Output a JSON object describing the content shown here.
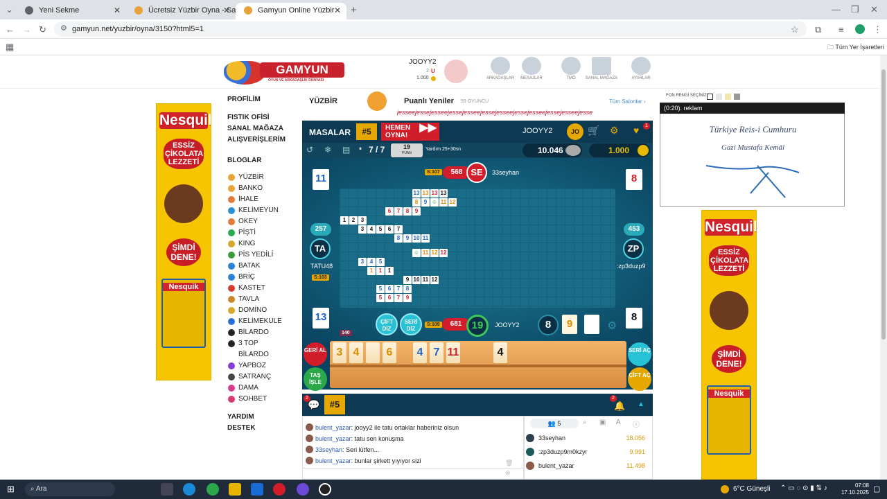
{
  "browser": {
    "tabs": [
      {
        "label": "Yeni Sekme"
      },
      {
        "label": "Ücretsiz Yüzbir Oyna - Salon Lis"
      },
      {
        "label": "Gamyun Online Yüzbir"
      }
    ],
    "url": "gamyun.net/yuzbir/oyna/3150?html5=1",
    "bookmarks_label": "Tüm Yer İşaretleri"
  },
  "header": {
    "logo_text": "GAMYUN",
    "logo_sub": "OYUN VE ARKADAŞLIK DÜNYASI",
    "username": "JOOYY2",
    "level": "2",
    "coins": "1.000",
    "nav": [
      {
        "label": "ARKADAŞLAR"
      },
      {
        "label": "MESAJLAR"
      },
      {
        "label": "TMÖ"
      },
      {
        "label": "SANAL MAĞAZA"
      },
      {
        "label": "AYARLAR"
      }
    ]
  },
  "leftmenu": {
    "top_links": [
      "PROFİLİM",
      "FISTIK OFİSİ",
      "SANAL MAĞAZA",
      "ALIŞVERİŞLERİM",
      "BLOGLAR"
    ],
    "games": [
      {
        "label": "YÜZBİR",
        "color": "#e8a23a"
      },
      {
        "label": "BANKO",
        "color": "#e8a23a"
      },
      {
        "label": "İHALE",
        "color": "#e07b39"
      },
      {
        "label": "KELİMEYUN",
        "color": "#2a8fd6"
      },
      {
        "label": "OKEY",
        "color": "#e07b39"
      },
      {
        "label": "PİŞTİ",
        "color": "#2aa84a"
      },
      {
        "label": "KING",
        "color": "#d6a52a"
      },
      {
        "label": "PİS YEDİLİ",
        "color": "#3a9a3a"
      },
      {
        "label": "BATAK",
        "color": "#2a7fd6"
      },
      {
        "label": "BRİÇ",
        "color": "#2a7fd6"
      },
      {
        "label": "KASTET",
        "color": "#d63a2a"
      },
      {
        "label": "TAVLA",
        "color": "#c9882a"
      },
      {
        "label": "DOMİNO",
        "color": "#d6a52a"
      },
      {
        "label": "KELİMEKULE",
        "color": "#2a6fd6"
      },
      {
        "label": "BİLARDO",
        "color": "#222222"
      },
      {
        "label": "3 TOP BİLARDO",
        "color": "#222222"
      },
      {
        "label": "YAPBOZ",
        "color": "#8a3ad6"
      },
      {
        "label": "SATRANÇ",
        "color": "#444444"
      },
      {
        "label": "DAMA",
        "color": "#d63a8a"
      },
      {
        "label": "SOHBET",
        "color": "#d63a6a"
      }
    ],
    "bottom_links": [
      "YARDIM",
      "DESTEK"
    ]
  },
  "ads": {
    "brand": "Nesquik",
    "slogan": "ESSİZ ÇİKOLATA LEZZETİ",
    "cta": "ŞİMDİ DENE!",
    "box_brand": "Nesquik"
  },
  "game": {
    "title": "YÜZBİR",
    "salon": "Puanlı Yeniler",
    "players_online": "59 OYUNCU",
    "all_salons": "Tüm Salonlar",
    "ticker": "jesseejessejesseejessejesseejessejesseejessejesseejessejesseejesse",
    "tables_label": "MASALAR",
    "table_no": "#5",
    "play_now": "HEMEN OYNA!",
    "me": "JOOYY2",
    "me_initials": "JO",
    "round": "7 / 7",
    "points": "19",
    "points_label": "PUAN",
    "help_text": "Yardım 25+30sn",
    "chips": "10.046",
    "gold": "1.000",
    "notif": "1"
  },
  "players": {
    "top": {
      "name": "33seyhan",
      "initials": "SE",
      "score": "568",
      "s": "S:107"
    },
    "left": {
      "name": "TATU48",
      "initials": "TA",
      "score": "257",
      "s": "S:103"
    },
    "right": {
      "name": ":zp3duzp9",
      "initials": "ZP",
      "score": "453"
    },
    "bottom": {
      "name": "JOOYY2",
      "score": "681",
      "s": "S:109",
      "timer": "19"
    }
  },
  "board": {
    "corner_tl": "11",
    "corner_tr": "8",
    "corner_bl": "13",
    "corner_br": "8",
    "deck_count": "140",
    "drawn_tile": "8",
    "discard_tile": "9",
    "cift_diz": "ÇİFT DİZ",
    "seri_diz": "SERİ DİZ",
    "rows": [
      {
        "tiles": [
          [
            "13",
            "blue"
          ],
          [
            "13",
            "orange"
          ],
          [
            "13",
            "red"
          ],
          [
            "13",
            "black"
          ]
        ]
      },
      {
        "tiles": [
          [
            "8",
            "orange"
          ],
          [
            "9",
            "blue"
          ],
          [
            "☺",
            "green"
          ],
          [
            "11",
            "orange"
          ],
          [
            "12",
            "orange"
          ]
        ]
      },
      {
        "tiles": [
          [
            "6",
            "red"
          ],
          [
            "7",
            "red"
          ],
          [
            "8",
            "red"
          ],
          [
            "9",
            "red"
          ]
        ]
      },
      {
        "tiles": [
          [
            "1",
            "black"
          ],
          [
            "2",
            "black"
          ],
          [
            "3",
            "black"
          ]
        ]
      },
      {
        "tiles": [
          [
            "3",
            "black"
          ],
          [
            "4",
            "black"
          ],
          [
            "5",
            "black"
          ],
          [
            "6",
            "black"
          ],
          [
            "7",
            "black"
          ]
        ]
      },
      {
        "tiles": [
          [
            "8",
            "blue"
          ],
          [
            "9",
            "blue"
          ],
          [
            "10",
            "blue"
          ],
          [
            "11",
            "blue"
          ]
        ]
      },
      {
        "tiles": [
          [
            "☺",
            "green"
          ],
          [
            "11",
            "orange"
          ],
          [
            "12",
            "orange"
          ],
          [
            "12",
            "red"
          ]
        ]
      },
      {
        "tiles": [
          [
            "3",
            "blue"
          ],
          [
            "4",
            "blue"
          ],
          [
            "5",
            "blue"
          ]
        ]
      },
      {
        "tiles": [
          [
            "1",
            "orange"
          ],
          [
            "1",
            "red"
          ],
          [
            "1",
            "black"
          ]
        ]
      },
      {
        "tiles": [
          [
            "9",
            "black"
          ],
          [
            "10",
            "black"
          ],
          [
            "11",
            "black"
          ],
          [
            "12",
            "black"
          ]
        ]
      },
      {
        "tiles": [
          [
            "5",
            "blue"
          ],
          [
            "6",
            "blue"
          ],
          [
            "7",
            "blue"
          ],
          [
            "8",
            "blue"
          ]
        ]
      },
      {
        "tiles": [
          [
            "5",
            "red"
          ],
          [
            "6",
            "red"
          ],
          [
            "7",
            "red"
          ],
          [
            "9",
            "red"
          ]
        ]
      }
    ]
  },
  "rack": {
    "tiles": [
      {
        "v": "3",
        "color": "orange"
      },
      {
        "v": "4",
        "color": "orange"
      },
      {
        "v": "",
        "color": "orange"
      },
      {
        "v": "6",
        "color": "orange"
      },
      {
        "v": "4",
        "color": "blue"
      },
      {
        "v": "7",
        "color": "blue"
      },
      {
        "v": "11",
        "color": "red"
      },
      {
        "v": "4",
        "color": "black"
      }
    ],
    "geri_al": "GERİ AL",
    "tas_isle": "TAŞ İŞLE",
    "seri_ac": "SERİ AÇ",
    "cift_ac": "ÇİFT AÇ"
  },
  "chat": {
    "tab": "#5",
    "badge": "2",
    "bell_badge": "2",
    "lines": [
      {
        "user": "bulent_yazar",
        "text": "jooyy2 ile tatu ortaklar haberiniz olsun"
      },
      {
        "user": "bulent_yazar",
        "text": "tatu sen konuşma"
      },
      {
        "user": "33seyhan",
        "text": "Seri lütfen..."
      },
      {
        "user": "bulent_yazar",
        "text": "bunlar şirkett yıyıyor sizi"
      }
    ],
    "online_count": "5",
    "users": [
      {
        "name": "33seyhan",
        "lvl": "5",
        "score": "18.056"
      },
      {
        "name": ":zp3duzp9m0kzyr",
        "lvl": "5",
        "score": "9.991"
      },
      {
        "name": "bulent_yazar",
        "lvl": "5",
        "score": "11.498"
      }
    ]
  },
  "rightpanel": {
    "bg_label": "FON RENGİ SEÇİNİZ:",
    "video_label": "(0:20). reklam",
    "video_title1": "Türkiye Reis-i Cumhuru",
    "video_title2": "Gazi Mustafa Kemâl"
  },
  "taskbar": {
    "search": "Ara",
    "weather": "6°C Güneşli",
    "time": "07:08",
    "date": "17.10.2025"
  }
}
